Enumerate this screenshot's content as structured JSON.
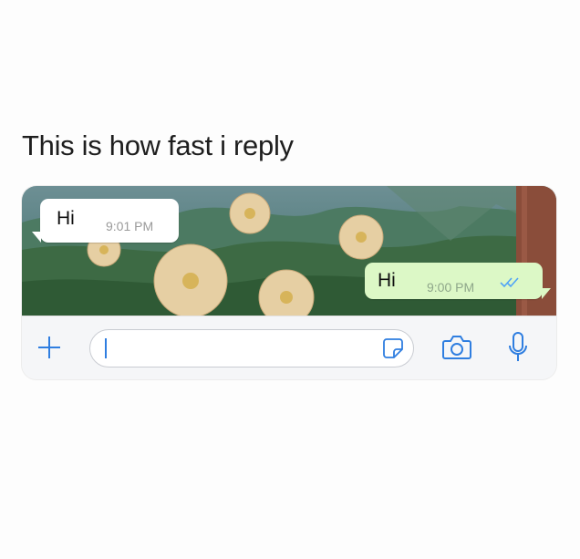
{
  "caption": "This is how fast i reply",
  "chat": {
    "incoming": {
      "text": "Hi",
      "time": "9:01 PM"
    },
    "outgoing": {
      "text": "Hi",
      "time": "9:00 PM",
      "status_icon": "double-check-icon"
    }
  },
  "input_bar": {
    "icons": [
      "plus-icon",
      "sticker-icon",
      "camera-icon",
      "microphone-icon"
    ],
    "message_value": ""
  },
  "colors": {
    "accent": "#2f7ee0",
    "outgoing_bubble": "#dcf8c6",
    "incoming_bubble": "#ffffff"
  }
}
